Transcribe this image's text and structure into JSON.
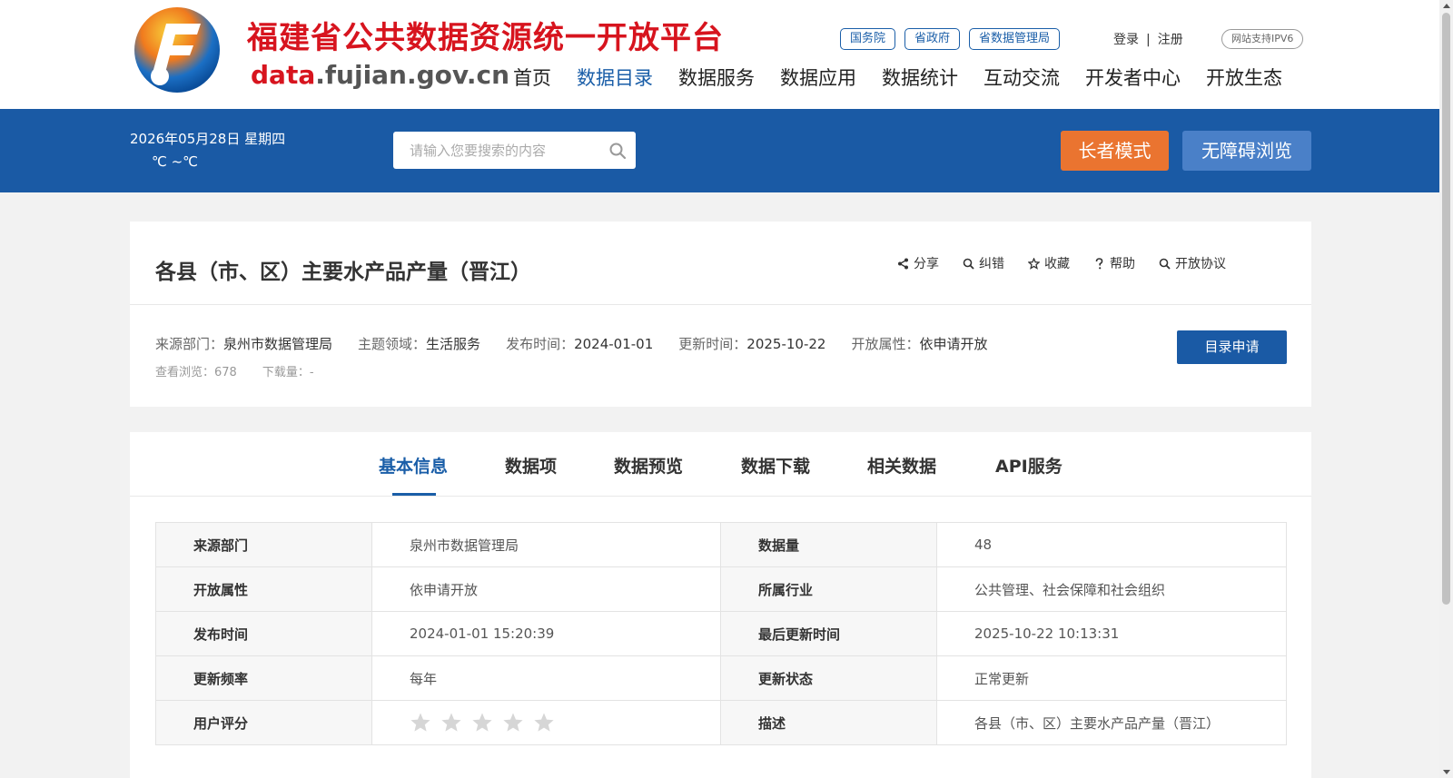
{
  "header": {
    "site_title": "福建省公共数据资源统一开放平台",
    "domain_prefix": "data",
    "domain_suffix": ".fujian.gov.cn",
    "top_links": [
      "国务院",
      "省政府",
      "省数据管理局"
    ],
    "login": "登录",
    "separator": "|",
    "register": "注册",
    "ipv6_badge": "网站支持IPV6",
    "nav": [
      "首页",
      "数据目录",
      "数据服务",
      "数据应用",
      "数据统计",
      "互动交流",
      "开发者中心",
      "开放生态"
    ],
    "active_nav": "数据目录"
  },
  "bluebar": {
    "date": "2026年05月28日   星期四",
    "temperature": "℃ ~℃",
    "search_placeholder": "请输入您要搜索的内容",
    "elder_mode": "长者模式",
    "accessible": "无障碍浏览"
  },
  "dataset": {
    "title": "各县（市、区）主要水产品产量（晋江）",
    "actions": [
      "分享",
      "纠错",
      "收藏",
      "帮助",
      "开放协议"
    ],
    "meta": [
      {
        "label": "来源部门：",
        "value": "泉州市数据管理局"
      },
      {
        "label": "主题领域：",
        "value": "生活服务"
      },
      {
        "label": "发布时间：",
        "value": "2024-01-01"
      },
      {
        "label": "更新时间：",
        "value": "2025-10-22"
      },
      {
        "label": "开放属性：",
        "value": "依申请开放"
      }
    ],
    "views_label": "查看浏览：",
    "views": "678",
    "downloads_label": "下载量：",
    "downloads": "-",
    "apply_button": "目录申请"
  },
  "tabs": [
    "基本信息",
    "数据项",
    "数据预览",
    "数据下载",
    "相关数据",
    "API服务"
  ],
  "active_tab": "基本信息",
  "basic_info": [
    {
      "k1": "来源部门",
      "v1": "泉州市数据管理局",
      "k2": "数据量",
      "v2": "48"
    },
    {
      "k1": "开放属性",
      "v1": "依申请开放",
      "k2": "所属行业",
      "v2": "公共管理、社会保障和社会组织"
    },
    {
      "k1": "发布时间",
      "v1": "2024-01-01 15:20:39",
      "k2": "最后更新时间",
      "v2": "2025-10-22 10:13:31"
    },
    {
      "k1": "更新频率",
      "v1": "每年",
      "k2": "更新状态",
      "v2": "正常更新"
    },
    {
      "k1": "用户评分",
      "v1": "",
      "k2": "描述",
      "v2": "各县（市、区）主要水产品产量（晋江）"
    }
  ],
  "rating": {
    "value": 0,
    "max": 5
  },
  "colors": {
    "brand_blue": "#1a5aa5",
    "brand_red": "#d7141e",
    "elder_orange": "#ea7430",
    "access_blue": "#4a80c8"
  }
}
